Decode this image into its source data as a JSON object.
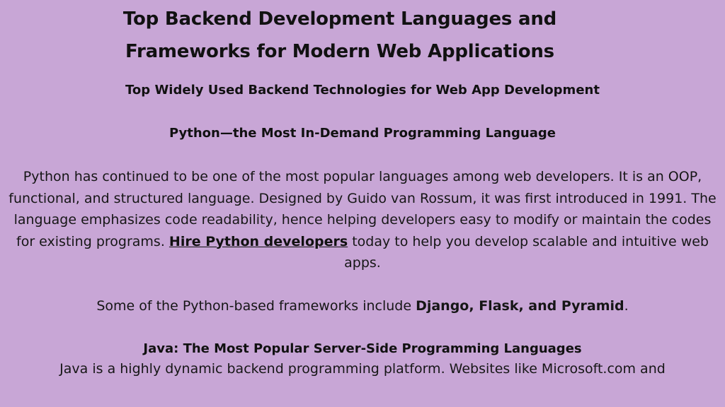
{
  "title": {
    "line1": "Top Backend Development Languages and",
    "line2": "Frameworks for Modern Web Applications"
  },
  "section_heading": "Top Widely Used Backend Technologies for Web App Development",
  "python": {
    "heading": "Python—the Most In-Demand Programming Language",
    "paragraph_before_link": "Python has continued to be one of the most popular languages among web developers. It is an OOP, functional, and structured language. Designed by Guido van Rossum, it was first introduced in 1991. The language emphasizes code readability, hence helping developers easy to modify or maintain the codes for existing programs. ",
    "link_text": "Hire Python developers",
    "paragraph_after_link": " today to help you develop scalable and intuitive web apps.",
    "frameworks_intro": "Some of the Python-based frameworks include ",
    "frameworks_list": "Django, Flask, and Pyramid",
    "frameworks_end": "."
  },
  "java": {
    "heading": "Java: The Most Popular Server-Side Programming Languages",
    "paragraph": "Java is a highly dynamic backend programming platform. Websites like Microsoft.com and"
  },
  "colors": {
    "background": "#c8a6d6",
    "text": "#111111"
  }
}
